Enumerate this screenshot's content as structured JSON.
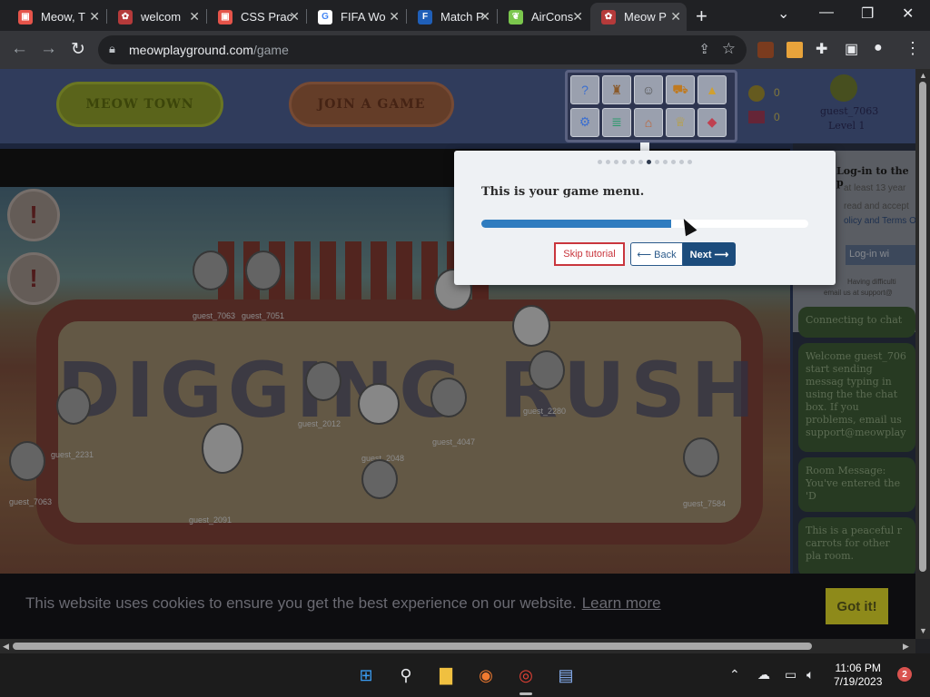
{
  "browser": {
    "tabs": [
      {
        "title": "Meow, T",
        "favicon": "meow-icon",
        "color": "#e5544a"
      },
      {
        "title": "welcom",
        "favicon": "meow-paw-icon",
        "color": "#b53a3a"
      },
      {
        "title": "CSS Prac",
        "favicon": "meow-icon",
        "color": "#e5544a"
      },
      {
        "title": "FIFA Wo",
        "favicon": "google-icon",
        "color": "#4285f4"
      },
      {
        "title": "Match P",
        "favicon": "f-icon",
        "color": "#1f5fb8"
      },
      {
        "title": "AirCons",
        "favicon": "leaf-icon",
        "color": "#7bc74d"
      },
      {
        "title": "Meow P",
        "favicon": "meow-paw-icon",
        "color": "#b53a3a"
      }
    ],
    "url_host": "meowplayground.com",
    "url_path": "/game"
  },
  "game": {
    "header_buttons": [
      "MEOW TOWN",
      "JOIN A GAME"
    ],
    "coins": "0",
    "gems": "0",
    "username": "guest_7063",
    "level": "Level 1",
    "scene_title": "DIGGING RUSH",
    "players": [
      "guest_7063",
      "guest_7051",
      "guest_2231",
      "guest_2280",
      "guest_4047",
      "guest_2048",
      "guest_7063",
      "guest_7584",
      "guest_2012",
      "guest_2091"
    ],
    "sidepanel": {
      "login_title": "Log-in to the p",
      "login_line1": "at least 13 year",
      "login_line2": "read and accept",
      "login_line3": "olicy and Terms O",
      "login_button": "Log-in wi",
      "login_help1": "Having difficulti",
      "login_help2": "email us at support@",
      "chat1": "Connecting to chat",
      "chat2": "Welcome guest_706 start sending messag typing in using the the chat box. If you problems, email us support@meowplay",
      "chat3": "Room Message: You've entered the 'D",
      "chat4": "This is a peaceful r carrots for other pla room."
    }
  },
  "menu_icons": [
    "help-icon",
    "bag-icon",
    "cat-icon",
    "cart-icon",
    "blocks-icon",
    "settings-icon",
    "stack-icon",
    "shop-icon",
    "trophy-icon",
    "cube-icon"
  ],
  "tutorial": {
    "step_index": 6,
    "step_count": 12,
    "message": "This is your game menu.",
    "progress": 0.58,
    "skip_label": "Skip tutorial",
    "back_label": "⟵ Back",
    "next_label": "Next ⟶"
  },
  "cookie": {
    "text": "This website uses cookies to ensure you get the best experience on our website.",
    "learn_more": "Learn more",
    "accept": "Got it!"
  },
  "taskbar": {
    "time": "11:06 PM",
    "date": "7/19/2023",
    "notification_count": "2"
  },
  "colors": {
    "accent": "#1c4c7c",
    "progress": "#2f7cbf",
    "skip_red": "#c9363d"
  }
}
